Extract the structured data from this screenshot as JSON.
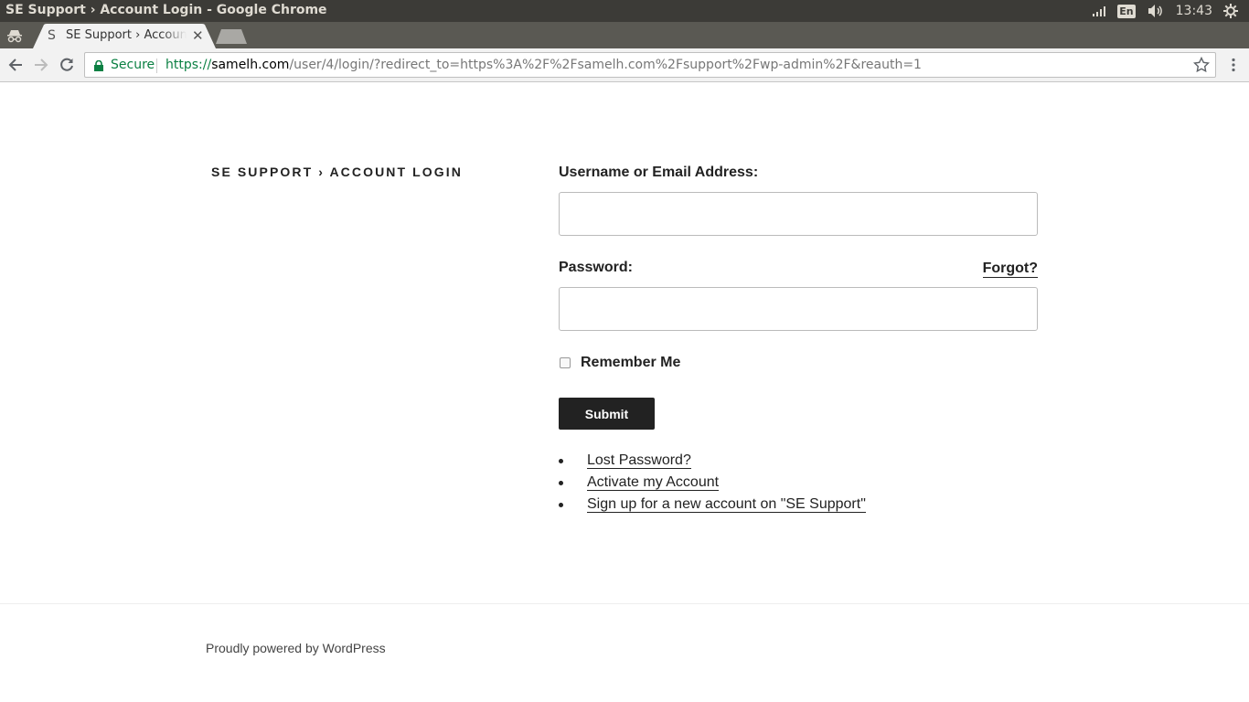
{
  "window": {
    "title": "SE Support › Account Login - Google Chrome"
  },
  "tray": {
    "language": "En",
    "clock": "13:43"
  },
  "tab": {
    "favicon": "S",
    "label": "SE Support › Account Login"
  },
  "toolbar": {
    "secure_label": "Secure",
    "url_scheme": "https://",
    "url_host": "samelh.com",
    "url_path": "/user/4/login/?redirect_to=https%3A%2F%2Fsamelh.com%2Fsupport%2Fwp-admin%2F&reauth=1"
  },
  "page": {
    "site_title": "SE SUPPORT › ACCOUNT LOGIN",
    "username_label": "Username or Email Address:",
    "username_value": "",
    "password_label": "Password:",
    "forgot_label": "Forgot?",
    "password_value": "",
    "remember_label": "Remember Me",
    "submit_label": "Submit",
    "links": [
      "Lost Password?",
      "Activate my Account",
      "Sign up for a new account on \"SE Support\""
    ],
    "footer": "Proudly powered by WordPress"
  },
  "colors": {
    "secure_green": "#0b8043",
    "button_bg": "#222222",
    "titlebar_bg": "#3c3b37"
  }
}
